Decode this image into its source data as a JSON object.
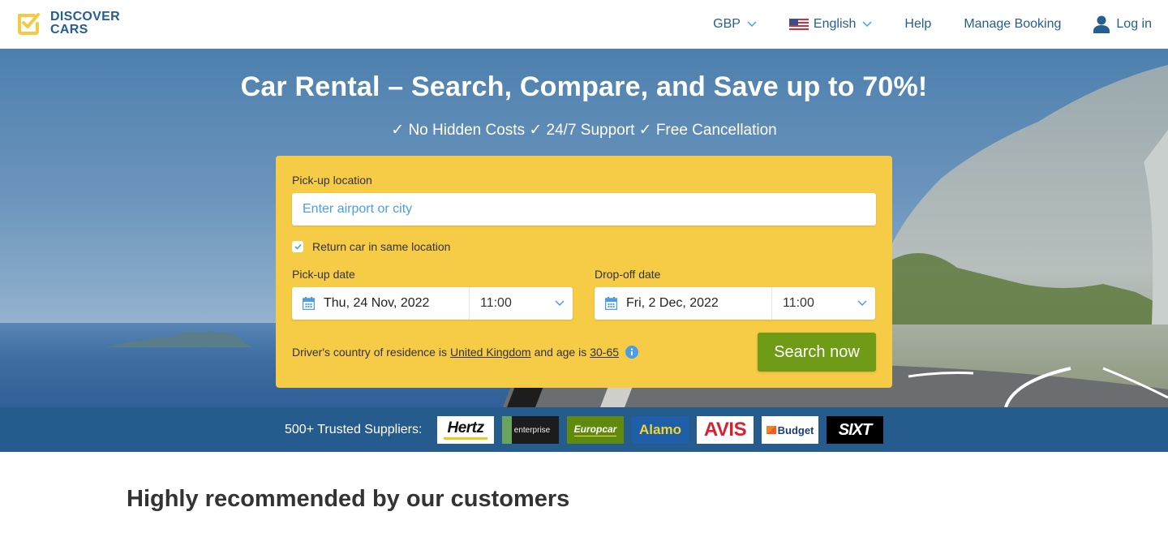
{
  "header": {
    "logo": {
      "line1": "DISCOVER",
      "line2": "CARS"
    },
    "nav": {
      "currency": "GBP",
      "language": "English",
      "help": "Help",
      "manage_booking": "Manage Booking",
      "login": "Log in"
    }
  },
  "hero": {
    "title": "Car Rental – Search, Compare, and Save up to 70%!",
    "subtitle": "✓ No Hidden Costs ✓ 24/7 Support ✓ Free Cancellation"
  },
  "search_form": {
    "pickup_location_label": "Pick-up location",
    "pickup_location_placeholder": "Enter airport or city",
    "pickup_location_value": "",
    "return_same_location": {
      "label": "Return car in same location",
      "checked": true
    },
    "pickup_date_label": "Pick-up date",
    "pickup_date": "Thu, 24 Nov, 2022",
    "pickup_time": "11:00",
    "dropoff_date_label": "Drop-off date",
    "dropoff_date": "Fri, 2 Dec, 2022",
    "dropoff_time": "11:00",
    "driver_text_1": "Driver's country of residence is",
    "driver_country": "United Kingdom",
    "driver_text_2": "and age is",
    "driver_age": "30-65",
    "search_button": "Search now"
  },
  "suppliers": {
    "label": "500+ Trusted Suppliers:",
    "logos": [
      "Hertz",
      "enterprise",
      "Europcar",
      "Alamo",
      "AVIS",
      "Budget",
      "SIXT"
    ]
  },
  "recommended": {
    "title": "Highly recommended by our customers"
  },
  "colors": {
    "brand_blue": "#265e8f",
    "search_yellow": "#f6cb46",
    "button_green": "#6f9b16",
    "suppliers_bar": "#265b8e",
    "link_blue": "#4a9ee8"
  }
}
